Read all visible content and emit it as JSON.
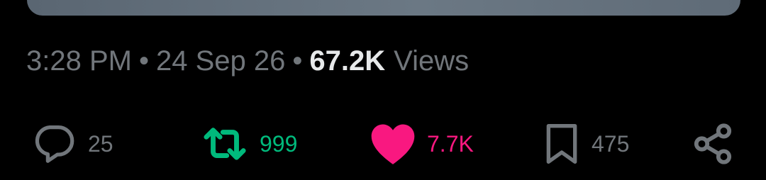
{
  "tweet_meta": {
    "time": "3:28 PM",
    "separator": "•",
    "date": "24 Sep 26",
    "views_count": "67.2K",
    "views_label": "Views"
  },
  "actions": {
    "reply": {
      "icon": "reply-icon",
      "count": "25",
      "color": "#71767b"
    },
    "repost": {
      "icon": "repost-icon",
      "count": "999",
      "color": "#00ba7c"
    },
    "like": {
      "icon": "heart-icon",
      "count": "7.7K",
      "color": "#f91880",
      "active": true
    },
    "bookmark": {
      "icon": "bookmark-icon",
      "count": "475",
      "color": "#71767b"
    },
    "share": {
      "icon": "share-icon",
      "color": "#71767b"
    }
  },
  "colors": {
    "background": "#000000",
    "muted_text": "#71767b",
    "primary_text": "#e7e9ea"
  }
}
